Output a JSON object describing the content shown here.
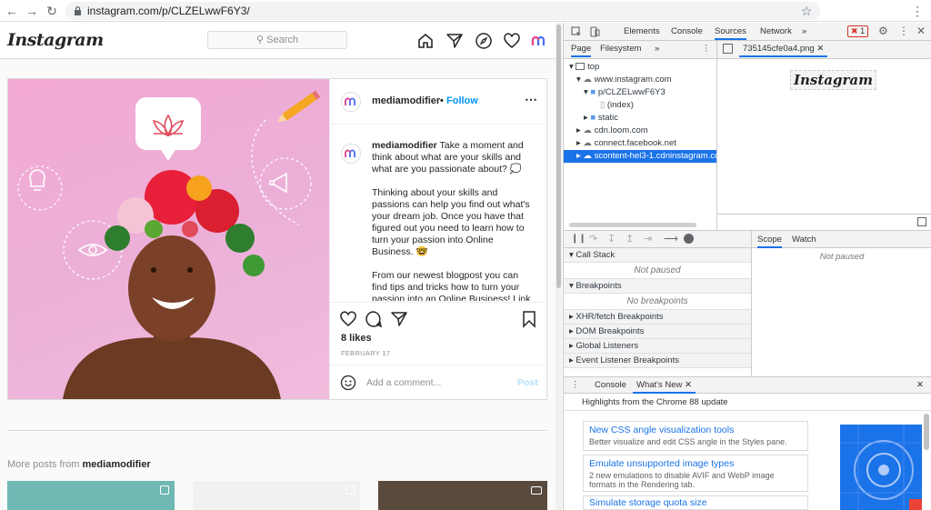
{
  "browser": {
    "url": "instagram.com/p/CLZELwwF6Y3/"
  },
  "instagram": {
    "logo": "Instagram",
    "search_placeholder": "Search",
    "post": {
      "username": "mediamodifier",
      "follow_label": "Follow",
      "caption_user": "mediamodifier",
      "caption_p1": "Take a moment and think about what are your skills and what are you passionate about? 💭",
      "caption_p2": "Thinking about your skills and passions can help you find out what's your dream job. Once you have that figured out you need to learn how to turn your passion into Online Business. 🤓",
      "caption_p3": "From our newest blogpost you can find tips and tricks how to turn your passion into an Online Business! Link",
      "likes": "8 likes",
      "date": "FEBRUARY 17",
      "comment_placeholder": "Add a comment...",
      "post_label": "Post"
    },
    "more_posts_prefix": "More posts from",
    "more_posts_user": "mediamodifier"
  },
  "devtools": {
    "main_tabs": [
      "Elements",
      "Console",
      "Sources",
      "Network"
    ],
    "active_tab": "Sources",
    "error_count": "1",
    "nav_tabs": [
      "Page",
      "Filesystem"
    ],
    "file_tab": "735145cfe0a4.png",
    "preview_text": "Instagram",
    "tree": [
      {
        "label": "top",
        "indent": 0
      },
      {
        "label": "www.instagram.com",
        "indent": 1
      },
      {
        "label": "p/CLZELwwF6Y3",
        "indent": 2
      },
      {
        "label": "(index)",
        "indent": 3
      },
      {
        "label": "static",
        "indent": 2
      },
      {
        "label": "cdn.loom.com",
        "indent": 1
      },
      {
        "label": "connect.facebook.net",
        "indent": 1
      },
      {
        "label": "scontent-hel3-1.cdninstagram.com",
        "indent": 1
      }
    ],
    "call_stack": "Call Stack",
    "not_paused": "Not paused",
    "breakpoints": "Breakpoints",
    "no_breakpoints": "No breakpoints",
    "xhr": "XHR/fetch Breakpoints",
    "dom": "DOM Breakpoints",
    "global": "Global Listeners",
    "event": "Event Listener Breakpoints",
    "scope": "Scope",
    "watch": "Watch",
    "scope_not_paused": "Not paused",
    "drawer_tabs": [
      "Console",
      "What's New"
    ],
    "highlights": "Highlights from the Chrome 88 update",
    "news": [
      {
        "title": "New CSS angle visualization tools",
        "desc": "Better visualize and edit CSS angle in the Styles pane."
      },
      {
        "title": "Emulate unsupported image types",
        "desc": "2 new emulations to disable AVIF and WebP image formats in the Rendering tab."
      },
      {
        "title": "Simulate storage quota size",
        "desc": ""
      }
    ]
  }
}
